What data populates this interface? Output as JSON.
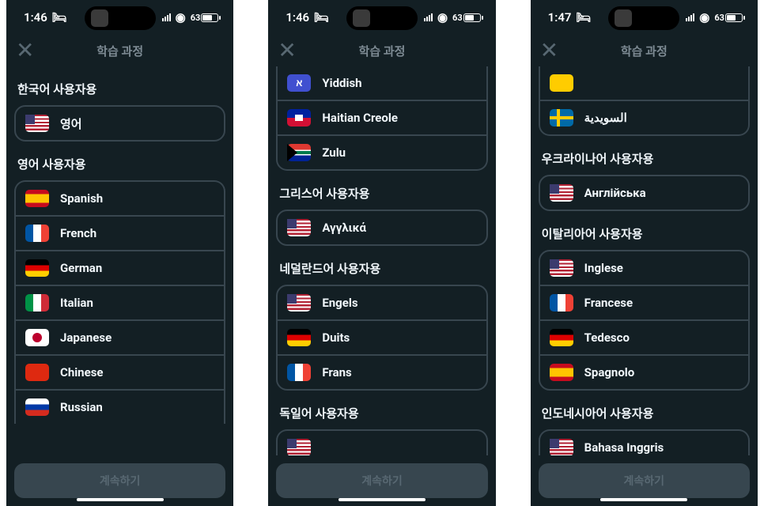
{
  "screens": [
    {
      "status": {
        "time": "1:46",
        "bed_icon": "bed-icon",
        "signal": "signal-icon",
        "wifi": "wifi-icon",
        "battery": "63"
      },
      "header": {
        "title": "학습 과정",
        "close": "✕"
      },
      "sections": [
        {
          "label": "한국어 사용자용",
          "items": [
            {
              "flag": "flag-us",
              "name": "영어"
            }
          ]
        },
        {
          "label": "영어 사용자용",
          "items": [
            {
              "flag": "flag-es",
              "name": "Spanish"
            },
            {
              "flag": "flag-fr",
              "name": "French"
            },
            {
              "flag": "flag-de",
              "name": "German"
            },
            {
              "flag": "flag-it",
              "name": "Italian"
            },
            {
              "flag": "flag-jp",
              "name": "Japanese"
            },
            {
              "flag": "flag-cn",
              "name": "Chinese"
            },
            {
              "flag": "flag-ru",
              "name": "Russian"
            }
          ],
          "partial_bottom": true
        }
      ],
      "continue": "계속하기"
    },
    {
      "status": {
        "time": "1:46",
        "bed_icon": "bed-icon",
        "signal": "signal-icon",
        "wifi": "wifi-icon",
        "battery": "63"
      },
      "header": {
        "title": "학습 과정",
        "close": "✕"
      },
      "sections": [
        {
          "label": null,
          "partial_top": true,
          "items": [
            {
              "flag": "flag-yi",
              "name": "Yiddish"
            },
            {
              "flag": "flag-ht",
              "name": "Haitian Creole"
            },
            {
              "flag": "flag-za",
              "name": "Zulu"
            }
          ]
        },
        {
          "label": "그리스어 사용자용",
          "items": [
            {
              "flag": "flag-us",
              "name": "Αγγλικά"
            }
          ]
        },
        {
          "label": "네덜란드어 사용자용",
          "items": [
            {
              "flag": "flag-us",
              "name": "Engels"
            },
            {
              "flag": "flag-de",
              "name": "Duits"
            },
            {
              "flag": "flag-fr",
              "name": "Frans"
            }
          ]
        },
        {
          "label": "독일어 사용자용",
          "partial_bottom": true,
          "items": [
            {
              "flag": "flag-us",
              "name": ""
            }
          ]
        }
      ],
      "continue": "계속하기"
    },
    {
      "status": {
        "time": "1:47",
        "bed_icon": "bed-icon",
        "signal": "signal-icon",
        "wifi": "wifi-icon",
        "battery": "63"
      },
      "header": {
        "title": "학습 과정",
        "close": "✕"
      },
      "sections": [
        {
          "label": null,
          "partial_top": true,
          "items": [
            {
              "flag": "flag-unknown",
              "name": ""
            },
            {
              "flag": "flag-se",
              "name": "السويدية"
            }
          ]
        },
        {
          "label": "우크라이나어 사용자용",
          "items": [
            {
              "flag": "flag-us",
              "name": "Англійська"
            }
          ]
        },
        {
          "label": "이탈리아어 사용자용",
          "items": [
            {
              "flag": "flag-us",
              "name": "Inglese"
            },
            {
              "flag": "flag-fr",
              "name": "Francese"
            },
            {
              "flag": "flag-de",
              "name": "Tedesco"
            },
            {
              "flag": "flag-es",
              "name": "Spagnolo"
            }
          ]
        },
        {
          "label": "인도네시아어 사용자용",
          "partial_bottom": true,
          "items": [
            {
              "flag": "flag-us",
              "name": "Bahasa Inggris"
            }
          ]
        }
      ],
      "continue": "계속하기"
    }
  ]
}
